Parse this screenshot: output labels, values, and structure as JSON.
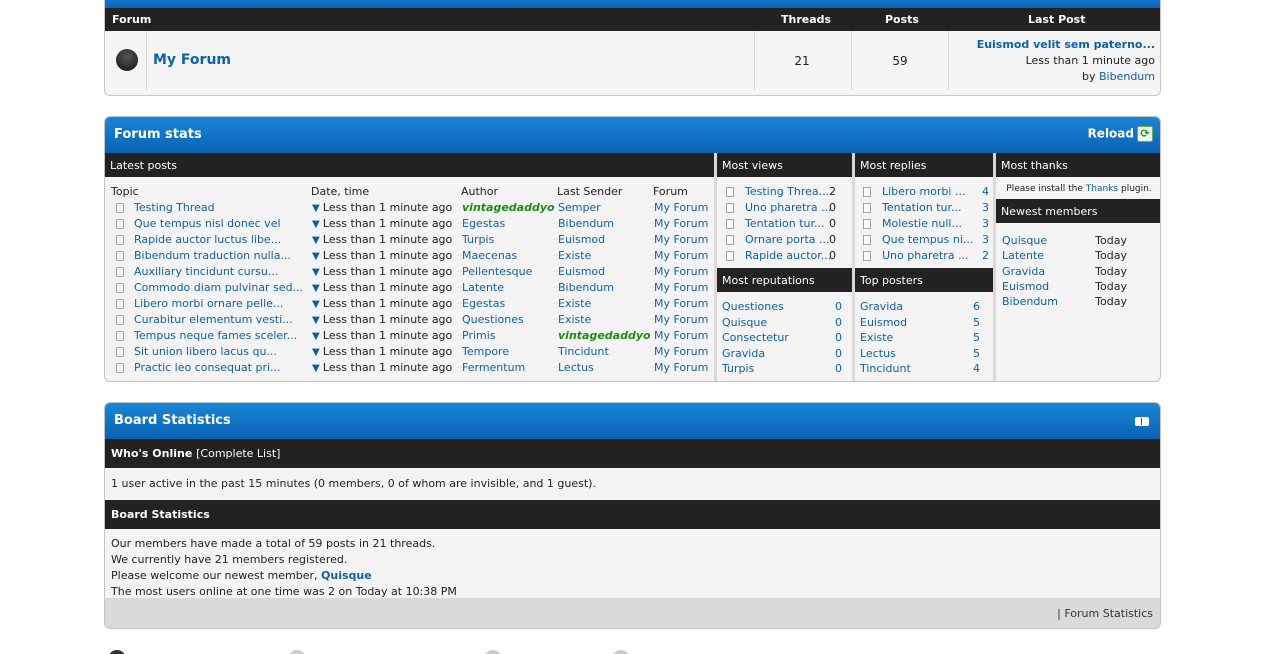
{
  "forum_table": {
    "headers": {
      "forum": "Forum",
      "threads": "Threads",
      "posts": "Posts",
      "last_post": "Last Post"
    },
    "row": {
      "name": "My Forum",
      "threads": "21",
      "posts": "59",
      "last_post_title": "Euismod velit sem paterno...",
      "last_post_time": "Less than 1 minute ago",
      "by_label": "by",
      "last_post_author": "Bibendum"
    }
  },
  "forum_stats": {
    "title": "Forum stats",
    "reload_label": "Reload",
    "latest_posts": {
      "title": "Latest posts",
      "headers": {
        "topic": "Topic",
        "date": "Date, time",
        "author": "Author",
        "last_sender": "Last Sender",
        "forum": "Forum"
      },
      "rows": [
        {
          "topic": "Testing Thread",
          "date": "Less than 1 minute ago",
          "author": "vintagedaddyo",
          "author_green": true,
          "sender": "Semper",
          "sender_green": false,
          "forum": "My Forum"
        },
        {
          "topic": "Que tempus nisl donec vel",
          "date": "Less than 1 minute ago",
          "author": "Egestas",
          "author_green": false,
          "sender": "Bibendum",
          "sender_green": false,
          "forum": "My Forum"
        },
        {
          "topic": "Rapide auctor luctus libe...",
          "date": "Less than 1 minute ago",
          "author": "Turpis",
          "author_green": false,
          "sender": "Euismod",
          "sender_green": false,
          "forum": "My Forum"
        },
        {
          "topic": "Bibendum traduction nulla...",
          "date": "Less than 1 minute ago",
          "author": "Maecenas",
          "author_green": false,
          "sender": "Existe",
          "sender_green": false,
          "forum": "My Forum"
        },
        {
          "topic": "Auxiliary tincidunt cursu...",
          "date": "Less than 1 minute ago",
          "author": "Pellentesque",
          "author_green": false,
          "sender": "Euismod",
          "sender_green": false,
          "forum": "My Forum"
        },
        {
          "topic": "Commodo diam pulvinar sed...",
          "date": "Less than 1 minute ago",
          "author": "Latente",
          "author_green": false,
          "sender": "Bibendum",
          "sender_green": false,
          "forum": "My Forum"
        },
        {
          "topic": "Libero morbi ornare pelle...",
          "date": "Less than 1 minute ago",
          "author": "Egestas",
          "author_green": false,
          "sender": "Existe",
          "sender_green": false,
          "forum": "My Forum"
        },
        {
          "topic": "Curabitur elementum vesti...",
          "date": "Less than 1 minute ago",
          "author": "Questiones",
          "author_green": false,
          "sender": "Existe",
          "sender_green": false,
          "forum": "My Forum"
        },
        {
          "topic": "Tempus neque fames sceler...",
          "date": "Less than 1 minute ago",
          "author": "Primis",
          "author_green": false,
          "sender": "vintagedaddyo",
          "sender_green": true,
          "forum": "My Forum"
        },
        {
          "topic": "Sit union libero lacus qu...",
          "date": "Less than 1 minute ago",
          "author": "Tempore",
          "author_green": false,
          "sender": "Tincidunt",
          "sender_green": false,
          "forum": "My Forum"
        },
        {
          "topic": "Practic leo consequat pri...",
          "date": "Less than 1 minute ago",
          "author": "Fermentum",
          "author_green": false,
          "sender": "Lectus",
          "sender_green": false,
          "forum": "My Forum"
        }
      ]
    },
    "most_views": {
      "title": "Most views",
      "rows": [
        {
          "label": "Testing Threa...",
          "value": "2"
        },
        {
          "label": "Uno pharetra ...",
          "value": "0"
        },
        {
          "label": "Tentation tur...",
          "value": "0"
        },
        {
          "label": "Ornare porta ...",
          "value": "0"
        },
        {
          "label": "Rapide auctor...",
          "value": "0"
        }
      ]
    },
    "most_replies": {
      "title": "Most replies",
      "rows": [
        {
          "label": "Libero morbi ...",
          "value": "4"
        },
        {
          "label": "Tentation tur...",
          "value": "3"
        },
        {
          "label": "Molestie null...",
          "value": "3"
        },
        {
          "label": "Que tempus ni...",
          "value": "3"
        },
        {
          "label": "Uno pharetra ...",
          "value": "2"
        }
      ]
    },
    "most_thanks": {
      "title": "Most thanks",
      "note_prefix": "Please install the",
      "note_link": "Thanks",
      "note_suffix": "plugin."
    },
    "most_reputations": {
      "title": "Most reputations",
      "rows": [
        {
          "label": "Questiones",
          "value": "0"
        },
        {
          "label": "Quisque",
          "value": "0"
        },
        {
          "label": "Consectetur",
          "value": "0"
        },
        {
          "label": "Gravida",
          "value": "0"
        },
        {
          "label": "Turpis",
          "value": "0"
        }
      ]
    },
    "top_posters": {
      "title": "Top posters",
      "rows": [
        {
          "label": "Gravida",
          "value": "6"
        },
        {
          "label": "Euismod",
          "value": "5"
        },
        {
          "label": "Existe",
          "value": "5"
        },
        {
          "label": "Lectus",
          "value": "5"
        },
        {
          "label": "Tincidunt",
          "value": "4"
        }
      ]
    },
    "newest_members": {
      "title": "Newest members",
      "rows": [
        {
          "label": "Quisque",
          "value": "Today"
        },
        {
          "label": "Latente",
          "value": "Today"
        },
        {
          "label": "Gravida",
          "value": "Today"
        },
        {
          "label": "Euismod",
          "value": "Today"
        },
        {
          "label": "Bibendum",
          "value": "Today"
        }
      ]
    }
  },
  "board_statistics": {
    "title": "Board Statistics",
    "whos_online_title": "Who's Online",
    "complete_list": "[Complete List]",
    "online_text": "1 user active in the past 15 minutes (0 members, 0 of whom are invisible, and 1 guest).",
    "stats_title": "Board Statistics",
    "line1": "Our members have made a total of 59 posts in 21 threads.",
    "line2": "We currently have 21 members registered.",
    "line3_prefix": "Please welcome our newest member,",
    "newest_member": "Quisque",
    "line4": "The most users online at one time was 2 on Today at 10:38 PM",
    "footer_link": "| Forum Statistics"
  },
  "colors": {
    "accent_blue": "#0a64b5",
    "link": "#0f5fb0",
    "green_user": "#1f8a14",
    "dark_header": "#222222"
  }
}
